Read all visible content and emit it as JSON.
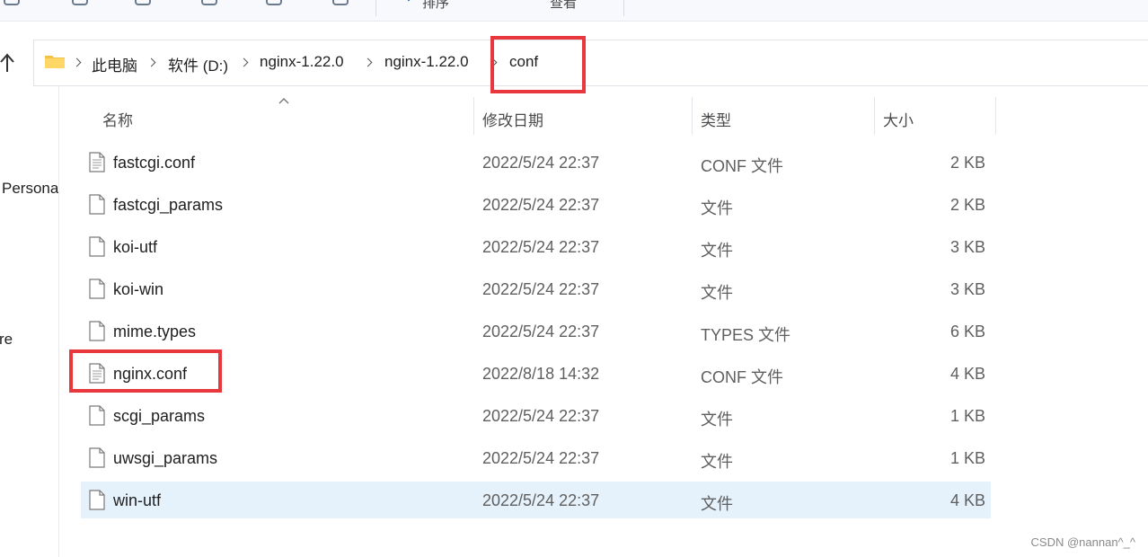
{
  "toolbar": {
    "sort_label": "排序",
    "view_label": "查看"
  },
  "address": {
    "crumbs": [
      "此电脑",
      "软件 (D:)",
      "nginx-1.22.0",
      "nginx-1.22.0",
      "conf"
    ]
  },
  "leftpane": {
    "items": [
      "Persona",
      "re"
    ]
  },
  "columns": {
    "name": "名称",
    "date": "修改日期",
    "type": "类型",
    "size": "大小"
  },
  "files": [
    {
      "name": "fastcgi.conf",
      "date": "2022/5/24 22:37",
      "type": "CONF 文件",
      "size": "2 KB",
      "icon": "conf-file-icon"
    },
    {
      "name": "fastcgi_params",
      "date": "2022/5/24 22:37",
      "type": "文件",
      "size": "2 KB",
      "icon": "file-icon"
    },
    {
      "name": "koi-utf",
      "date": "2022/5/24 22:37",
      "type": "文件",
      "size": "3 KB",
      "icon": "file-icon"
    },
    {
      "name": "koi-win",
      "date": "2022/5/24 22:37",
      "type": "文件",
      "size": "3 KB",
      "icon": "file-icon"
    },
    {
      "name": "mime.types",
      "date": "2022/5/24 22:37",
      "type": "TYPES 文件",
      "size": "6 KB",
      "icon": "file-icon"
    },
    {
      "name": "nginx.conf",
      "date": "2022/8/18 14:32",
      "type": "CONF 文件",
      "size": "4 KB",
      "icon": "conf-file-icon"
    },
    {
      "name": "scgi_params",
      "date": "2022/5/24 22:37",
      "type": "文件",
      "size": "1 KB",
      "icon": "file-icon"
    },
    {
      "name": "uwsgi_params",
      "date": "2022/5/24 22:37",
      "type": "文件",
      "size": "1 KB",
      "icon": "file-icon"
    },
    {
      "name": "win-utf",
      "date": "2022/5/24 22:37",
      "type": "文件",
      "size": "4 KB",
      "icon": "file-icon"
    }
  ],
  "selected_file": "win-utf",
  "highlight_color": "#e8383d",
  "selection_color": "#e5f1fb",
  "watermark": "CSDN @nannan^_^"
}
